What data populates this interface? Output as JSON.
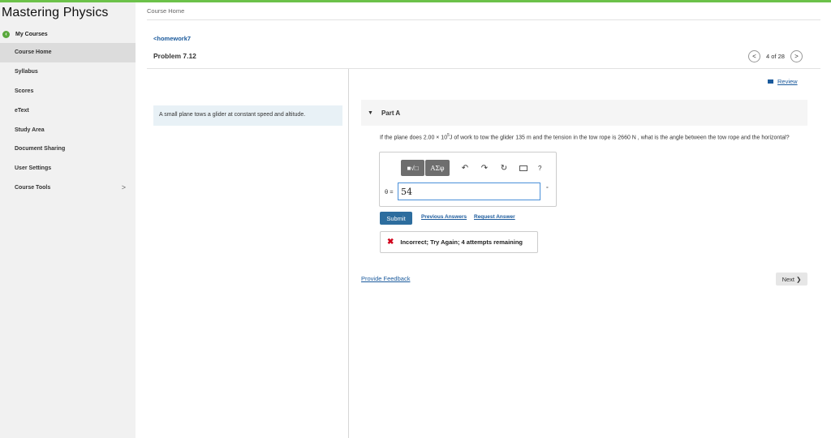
{
  "app": {
    "title": "Mastering Physics"
  },
  "sidebar": {
    "my_courses": "My Courses",
    "items": [
      {
        "label": "Course Home",
        "active": true
      },
      {
        "label": "Syllabus"
      },
      {
        "label": "Scores"
      },
      {
        "label": "eText"
      },
      {
        "label": "Study Area"
      },
      {
        "label": "Document Sharing"
      },
      {
        "label": "User Settings"
      },
      {
        "label": "Course Tools",
        "chevron": ">"
      }
    ]
  },
  "header": {
    "breadcrumb": "Course Home",
    "back_link": "<homework7",
    "problem_title": "Problem 7.12",
    "pager": {
      "prev": "<",
      "text": "4 of 28",
      "next": ">"
    }
  },
  "problem": {
    "intro": "A small plane tows a glider at constant speed and altitude.",
    "review_label": "Review",
    "part_label": "Part A",
    "question_parts": [
      "If the plane does 2.00 × 10",
      "5",
      "J of work to tow the glider 135 m and the tension in the tow rope is 2660 N , what is the angle between the tow rope and the horizontal?"
    ]
  },
  "answer": {
    "toolbar": {
      "template_label": "■√□",
      "greek_label": "AΣφ",
      "help_label": "?",
      "undo_icon": "↶",
      "redo_icon": "↷",
      "reset_icon": "↻"
    },
    "variable_label": "θ =",
    "value": "54",
    "unit": "°",
    "submit_label": "Submit",
    "previous_answers_label": "Previous Answers",
    "request_answer_label": "Request Answer"
  },
  "feedback": {
    "icon": "✖",
    "message": "Incorrect; Try Again; 4 attempts remaining",
    "status_color": "#d0021b"
  },
  "footer": {
    "provide_feedback": "Provide Feedback",
    "next_label": "Next ❯"
  },
  "colors": {
    "accent_green": "#6cc24a",
    "link_blue": "#1b5a9c",
    "submit_blue": "#2d6d9e"
  }
}
